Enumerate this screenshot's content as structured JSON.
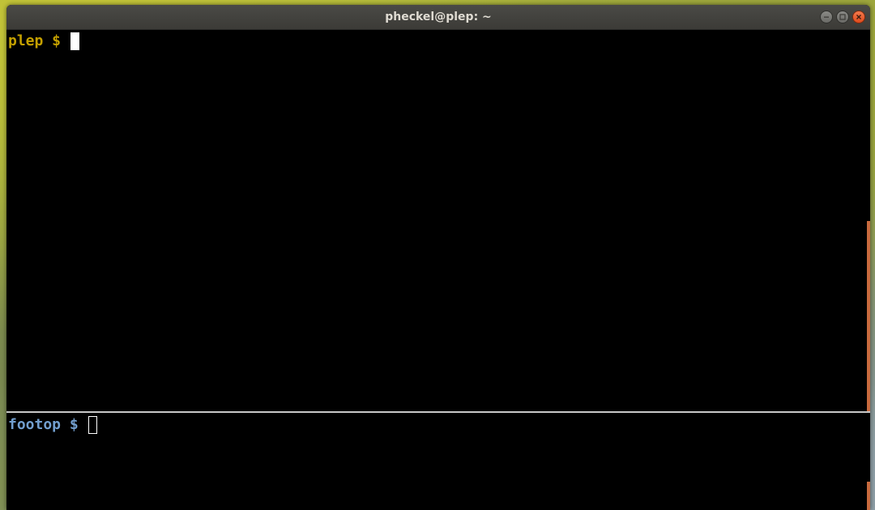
{
  "window": {
    "title": "pheckel@plep: ~",
    "buttons": {
      "minimize_icon": "minimize-icon",
      "maximize_icon": "maximize-icon",
      "close_icon": "close-icon"
    }
  },
  "terminal_top": {
    "prompt": "plep $ ",
    "prompt_color": "#c4a000",
    "cursor": "block",
    "scroll_position": 0.5
  },
  "terminal_bottom": {
    "prompt": "footop $ ",
    "prompt_color": "#729fcf",
    "cursor": "hollow",
    "scroll_position": 1.0
  },
  "colors": {
    "background": "#000000",
    "titlebar": "#3c3b37",
    "title_text": "#dfdbd2",
    "close_button": "#e95420",
    "scroll_thumb": "#c86a3e"
  }
}
